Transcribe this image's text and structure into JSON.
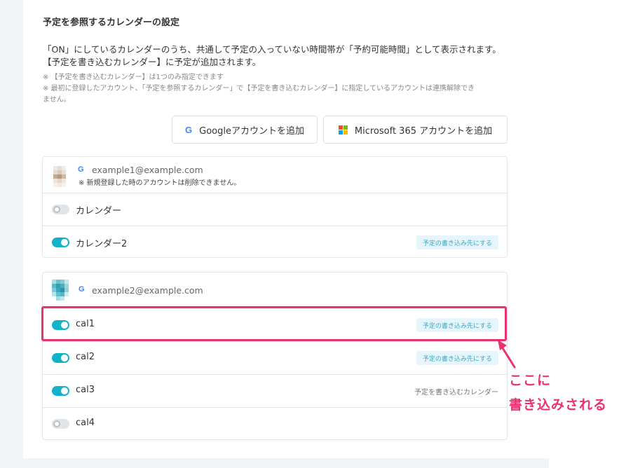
{
  "section": {
    "title": "予定を参照するカレンダーの設定",
    "description_line1": "「ON」にしているカレンダーのうち、共通して予定の入っていない時間帯が「予約可能時間」として表示されます。",
    "description_line2": "【予定を書き込むカレンダー】に予定が追加されます。",
    "note1": "※ 【予定を書き込むカレンダー】は1つのみ指定できます",
    "note2a": "※ 最初に登録したアカウント、「予定を参照するカレンダー」で【予定を書き込むカレンダー】に指定しているアカウントは連携解除でき",
    "note2b": "ません。"
  },
  "buttons": {
    "google_add": "Googleアカウントを追加",
    "microsoft_add": "Microsoft 365 アカウントを追加"
  },
  "icons": {
    "google_letter": "G",
    "microsoft_colors": [
      "#f25022",
      "#7fba00",
      "#00a4ef",
      "#ffb900"
    ]
  },
  "accounts": [
    {
      "email": "example1@example.com",
      "note": "※ 新規登録した時のアカウントは削除できません。",
      "calendars": [
        {
          "name": "カレンダー",
          "on": false,
          "action": ""
        },
        {
          "name": "カレンダー2",
          "on": true,
          "action": "予定の書き込み先にする"
        }
      ]
    },
    {
      "email": "example2@example.com",
      "calendars": [
        {
          "name": "cal1",
          "on": true,
          "action": "予定の書き込み先にする"
        },
        {
          "name": "cal2",
          "on": true,
          "action": "予定の書き込み先にする"
        },
        {
          "name": "cal3",
          "on": true,
          "action": "予定を書き込むカレンダー"
        },
        {
          "name": "cal4",
          "on": false,
          "action": ""
        }
      ]
    }
  ],
  "annotation": {
    "line1": "ここに",
    "line2": "書き込みされる",
    "color": "#e8336e"
  },
  "colors": {
    "toggle_on": "#12b3c9",
    "accent_button_text": "#3aa7c4"
  }
}
